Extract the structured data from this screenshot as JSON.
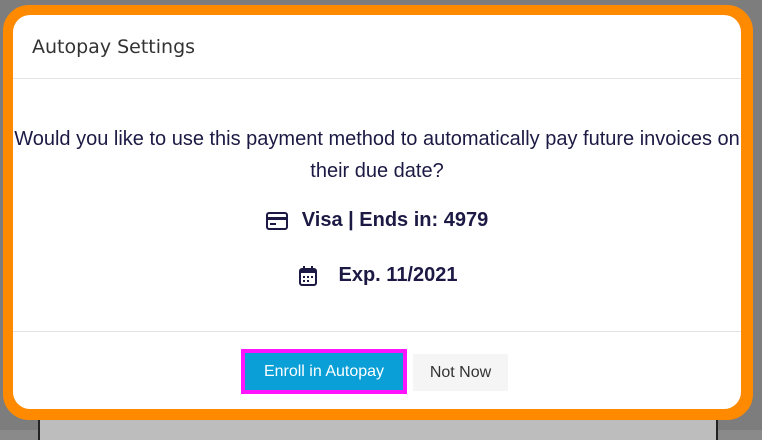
{
  "modal": {
    "title": "Autopay Settings",
    "question": "Would you like to use this payment method to automatically pay future invoices on their due date?",
    "card_info": "Visa | Ends in: 4979",
    "expiration": "Exp. 11/2021",
    "card_icon": "credit-card-icon",
    "calendar_icon": "calendar-icon"
  },
  "buttons": {
    "enroll_label": "Enroll in Autopay",
    "not_now_label": "Not Now"
  },
  "colors": {
    "highlight_frame": "#ff8a00",
    "focus_outline": "#ff14ff",
    "primary_button": "#0a9fd6",
    "text_dark": "#1c1a44"
  }
}
